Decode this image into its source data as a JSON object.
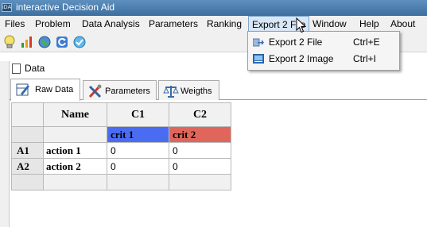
{
  "window": {
    "title": "interactive Decision Aid",
    "app_icon": "iDA"
  },
  "menubar": {
    "items": [
      {
        "label": "Files"
      },
      {
        "label": "Problem"
      },
      {
        "label": "Data Analysis"
      },
      {
        "label": "Parameters"
      },
      {
        "label": "Ranking"
      },
      {
        "label": "Export 2 File",
        "active": true
      },
      {
        "label": "Window"
      },
      {
        "label": "Help"
      },
      {
        "label": "About"
      }
    ]
  },
  "toolbar": {
    "buttons": [
      {
        "icon": "lightbulb-icon"
      },
      {
        "icon": "bar-chart-icon"
      },
      {
        "icon": "globe-icon"
      },
      {
        "icon": "refresh-icon"
      },
      {
        "icon": "check-icon"
      }
    ]
  },
  "export_menu": {
    "items": [
      {
        "label": "Export 2 File",
        "shortcut": "Ctrl+E",
        "icon": "export-arrow-icon"
      },
      {
        "label": "Export 2 Image",
        "shortcut": "Ctrl+I",
        "icon": "image-icon"
      }
    ]
  },
  "frame": {
    "title": "Data",
    "tabs": [
      {
        "label": "Raw Data",
        "icon": "edit-table-icon",
        "active": true
      },
      {
        "label": "Parameters",
        "icon": "tools-icon"
      },
      {
        "label": "Weigths",
        "icon": "scales-icon"
      }
    ]
  },
  "table": {
    "name_header": "Name",
    "criteria": [
      {
        "header": "C1",
        "name": "crit  1",
        "color": "#4a6cf2"
      },
      {
        "header": "C2",
        "name": "crit  2",
        "color": "#e0665c"
      }
    ],
    "rows": [
      {
        "id": "A1",
        "name": "action 1",
        "values": [
          "0",
          "0"
        ]
      },
      {
        "id": "A2",
        "name": "action 2",
        "values": [
          "0",
          "0"
        ]
      }
    ]
  }
}
